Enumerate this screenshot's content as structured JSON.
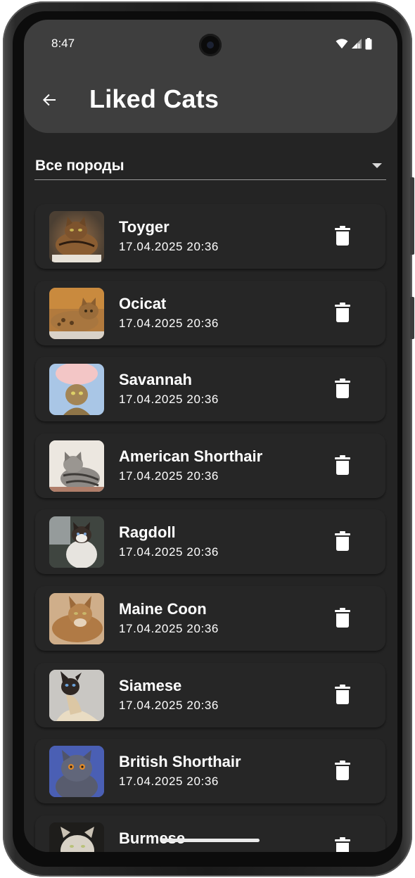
{
  "status_bar": {
    "time": "8:47"
  },
  "app_bar": {
    "title": "Liked Cats"
  },
  "filter": {
    "selected": "Все породы"
  },
  "items": [
    {
      "name": "Toyger",
      "date": "17.04.2025 20:36"
    },
    {
      "name": "Ocicat",
      "date": "17.04.2025 20:36"
    },
    {
      "name": "Savannah",
      "date": "17.04.2025 20:36"
    },
    {
      "name": "American Shorthair",
      "date": "17.04.2025 20:36"
    },
    {
      "name": "Ragdoll",
      "date": "17.04.2025 20:36"
    },
    {
      "name": "Maine Coon",
      "date": "17.04.2025 20:36"
    },
    {
      "name": "Siamese",
      "date": "17.04.2025 20:36"
    },
    {
      "name": "British Shorthair",
      "date": "17.04.2025 20:36"
    },
    {
      "name": "Burmese",
      "date": ""
    }
  ],
  "colors": {
    "background": "#242424",
    "app_bar": "#3e3e3e",
    "card": "#262626",
    "text": "#ffffff"
  }
}
